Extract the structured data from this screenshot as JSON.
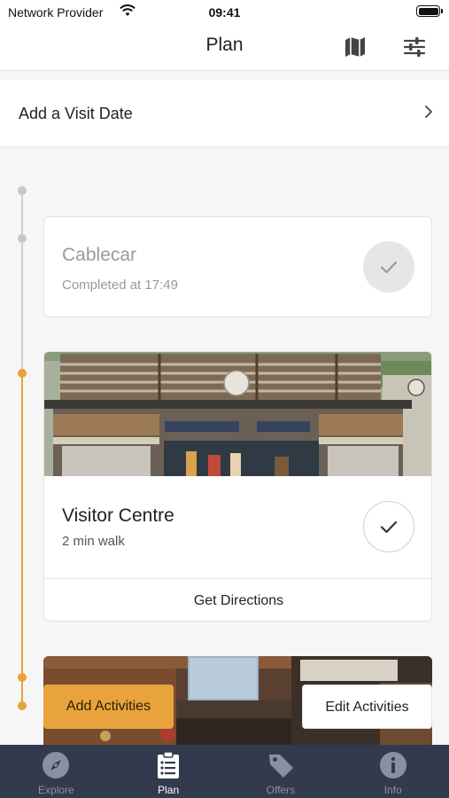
{
  "status_bar": {
    "carrier": "Network Provider",
    "time": "09:41"
  },
  "nav": {
    "title": "Plan",
    "map_icon": "map-icon",
    "filter_icon": "sliders-icon"
  },
  "visit_date": {
    "label": "Add a Visit Date"
  },
  "plan_items": [
    {
      "title": "Cablecar",
      "subtitle": "Completed at 17:49",
      "status": "completed"
    },
    {
      "title": "Visitor Centre",
      "subtitle": "2 min walk",
      "status": "pending",
      "action": "Get Directions"
    },
    {
      "title": "",
      "status": "upcoming"
    }
  ],
  "activities": {
    "add_label": "Add Activities",
    "edit_label": "Edit Activities"
  },
  "tabs": [
    {
      "label": "Explore",
      "icon": "compass-icon"
    },
    {
      "label": "Plan",
      "icon": "clipboard-icon",
      "active": true
    },
    {
      "label": "Offers",
      "icon": "tag-icon"
    },
    {
      "label": "Info",
      "icon": "info-icon"
    }
  ],
  "colors": {
    "accent": "#e8a33d",
    "tab_bar": "#323a4e",
    "timeline_done": "#cfcfcf"
  }
}
